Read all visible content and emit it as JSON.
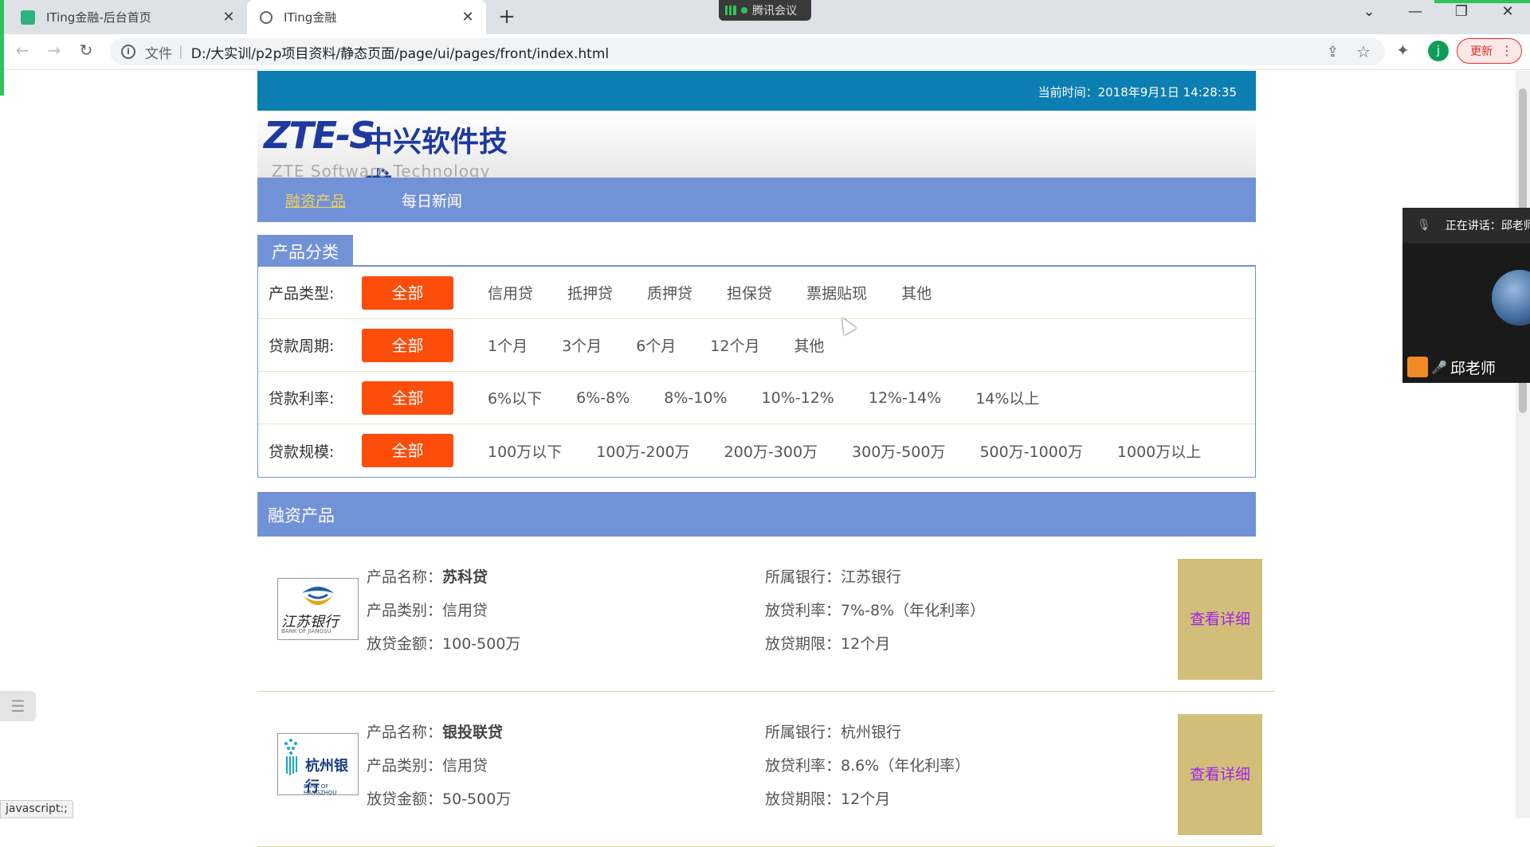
{
  "browser": {
    "tabs": [
      {
        "title": "ITing金融-后台首页",
        "favicon": "iting-favicon-icon",
        "color": "#2db37e"
      },
      {
        "title": "ITing金融",
        "favicon": "globe-icon",
        "active": true
      }
    ],
    "meeting_pill": "腾讯会议",
    "address": {
      "scheme": "文件",
      "url": "D:/大实训/p2p项目资料/静态页面/page/ui/pages/front/index.html"
    },
    "avatar_letter": "j",
    "update_label": "更新",
    "status_url": "javascript:;"
  },
  "page": {
    "current_time": "当前时间：2018年9月1日 14:28:35",
    "logo": {
      "mark": "ZTE-S",
      "cn": "中兴软件技术",
      "en": "ZTE Software Technology"
    },
    "nav": [
      "融资产品",
      "每日新闻"
    ],
    "category_title": "产品分类",
    "filters": [
      {
        "label": "产品类型:",
        "all": "全部",
        "options": [
          "信用贷",
          "抵押贷",
          "质押贷",
          "担保贷",
          "票据贴现",
          "其他"
        ]
      },
      {
        "label": "贷款周期:",
        "all": "全部",
        "options": [
          "1个月",
          "3个月",
          "6个月",
          "12个月",
          "其他"
        ]
      },
      {
        "label": "贷款利率:",
        "all": "全部",
        "options": [
          "6%以下",
          "6%-8%",
          "8%-10%",
          "10%-12%",
          "12%-14%",
          "14%以上"
        ]
      },
      {
        "label": "贷款规模:",
        "all": "全部",
        "options": [
          "100万以下",
          "100万-200万",
          "200万-300万",
          "300万-500万",
          "500万-1000万",
          "1000万以上"
        ]
      }
    ],
    "products_title": "融资产品",
    "products": [
      {
        "logo_text": "江苏银行",
        "logo_sub": "BANK OF JIANGSU",
        "name_label": "产品名称：",
        "name": "苏科贷",
        "type_label": "产品类别：",
        "type": "信用贷",
        "amount_label": "放贷金额：",
        "amount": "100-500万",
        "bank_label": "所属银行：",
        "bank": "江苏银行",
        "rate_label": "放贷利率：",
        "rate": "7%-8%（年化利率）",
        "term_label": "放贷期限：",
        "term": "12个月",
        "detail": "查看详细"
      },
      {
        "logo_text": "杭州银行",
        "logo_sub": "BANK OF HANGZHOU",
        "name_label": "产品名称：",
        "name": "银投联贷",
        "type_label": "产品类别：",
        "type": "信用贷",
        "amount_label": "放贷金额：",
        "amount": "50-500万",
        "bank_label": "所属银行：",
        "bank": "杭州银行",
        "rate_label": "放贷利率：",
        "rate": "8.6%（年化利率）",
        "term_label": "放贷期限：",
        "term": "12个月",
        "detail": "查看详细"
      }
    ]
  },
  "meeting_panel": {
    "speaking": "正在讲话：邱老师",
    "name": "邱老师"
  }
}
